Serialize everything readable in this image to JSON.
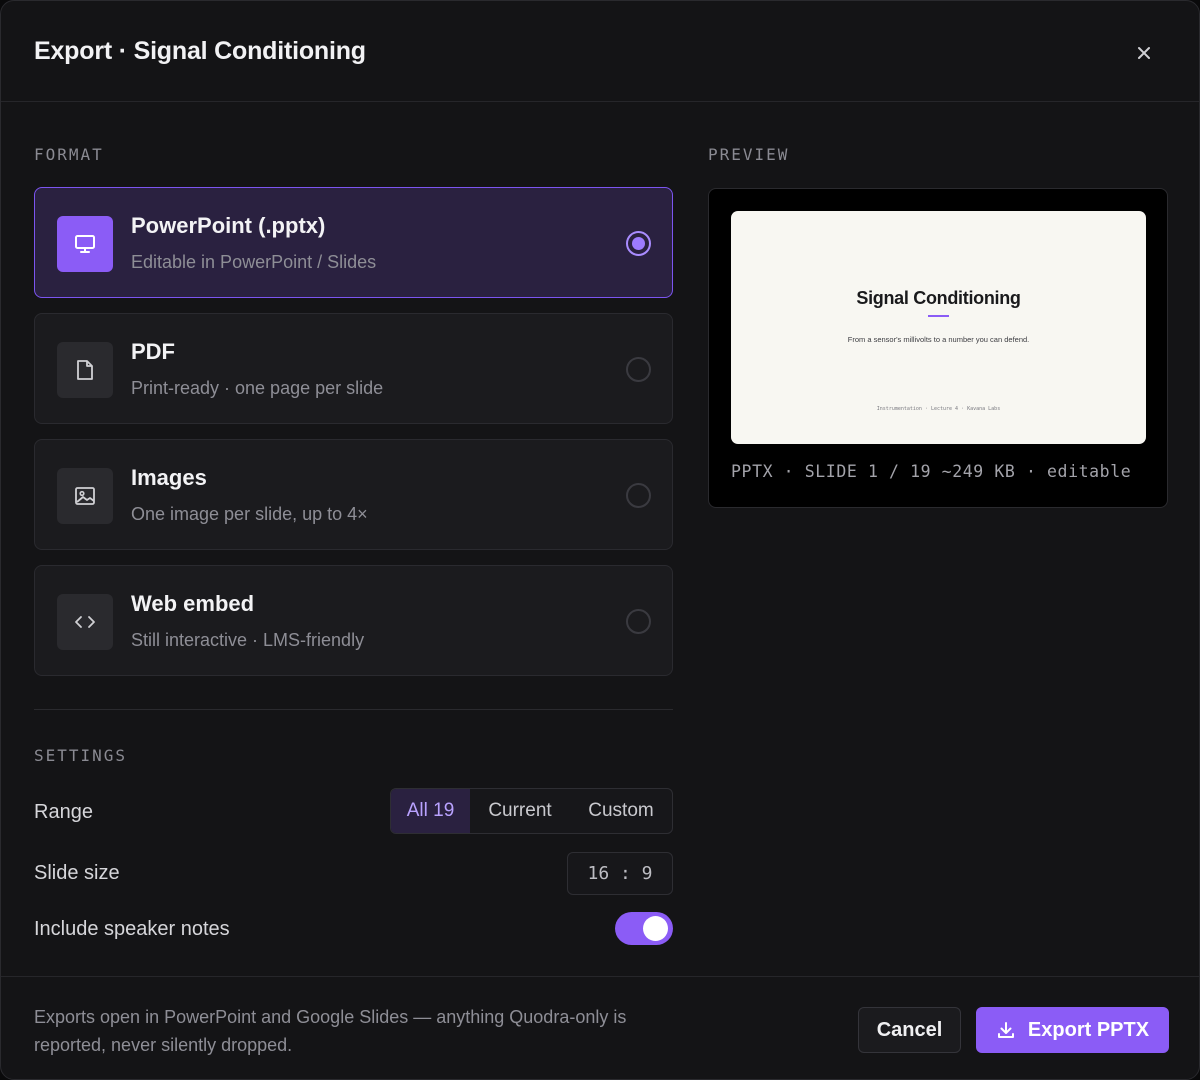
{
  "dialog": {
    "title": "Export · Signal Conditioning",
    "close_icon": "close-icon",
    "close_glyph": "×"
  },
  "format_section": {
    "label": "FORMAT",
    "options": [
      {
        "name": "PowerPoint (.pptx)",
        "desc": "Editable in PowerPoint / Slides",
        "icon": "monitor-icon",
        "selected": true
      },
      {
        "name": "PDF",
        "desc": "Print-ready · one page per slide",
        "icon": "file-icon",
        "selected": false
      },
      {
        "name": "Images",
        "desc": "One image per slide, up to 4×",
        "icon": "image-icon",
        "selected": false
      },
      {
        "name": "Web embed",
        "desc": "Still interactive · LMS-friendly",
        "icon": "code-icon",
        "selected": false
      }
    ]
  },
  "settings": {
    "label": "SETTINGS",
    "range": {
      "label": "Range",
      "options": [
        "All 19",
        "Current",
        "Custom"
      ],
      "selected": "All 19"
    },
    "slide_size": {
      "label": "Slide size",
      "value": "16 : 9"
    },
    "speaker_notes": {
      "label": "Include speaker notes",
      "enabled": true
    }
  },
  "preview": {
    "label": "PREVIEW",
    "slide": {
      "title": "Signal Conditioning",
      "subtitle": "From a sensor's millivolts to a number you can defend.",
      "footer": "Instrumentation · Lecture 4 · Kavana Labs"
    },
    "meta": "PPTX · SLIDE 1 / 19 ~249 KB · editable"
  },
  "footer": {
    "note": "Exports open in PowerPoint and Google Slides — anything Quodra-only is reported, never silently dropped.",
    "cancel_label": "Cancel",
    "export_label": "Export PPTX",
    "export_icon": "download-icon"
  },
  "colors": {
    "accent": "#8b5cf6",
    "background": "#141416",
    "selected_card": "#2a2140"
  }
}
